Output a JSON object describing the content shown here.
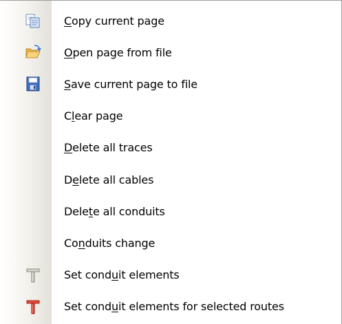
{
  "menu": {
    "items": [
      {
        "pre": "",
        "key": "C",
        "post": "opy current page",
        "icon": "copy-page-icon"
      },
      {
        "pre": "",
        "key": "O",
        "post": "pen page from file",
        "icon": "open-folder-icon"
      },
      {
        "pre": "",
        "key": "S",
        "post": "ave current page to file",
        "icon": "floppy-disk-icon"
      },
      {
        "pre": "C",
        "key": "l",
        "post": "ear page",
        "icon": ""
      },
      {
        "pre": "",
        "key": "D",
        "post": "elete all traces",
        "icon": ""
      },
      {
        "pre": "D",
        "key": "e",
        "post": "lete all cables",
        "icon": ""
      },
      {
        "pre": "Dele",
        "key": "t",
        "post": "e all conduits",
        "icon": ""
      },
      {
        "pre": "Co",
        "key": "n",
        "post": "duits change",
        "icon": ""
      },
      {
        "pre": "Set cond",
        "key": "u",
        "post": "it elements",
        "icon": "conduit-pin-gray-icon"
      },
      {
        "pre": "Set cond",
        "key": "u",
        "post": "it elements for selected routes",
        "icon": "conduit-pin-red-icon"
      }
    ]
  }
}
